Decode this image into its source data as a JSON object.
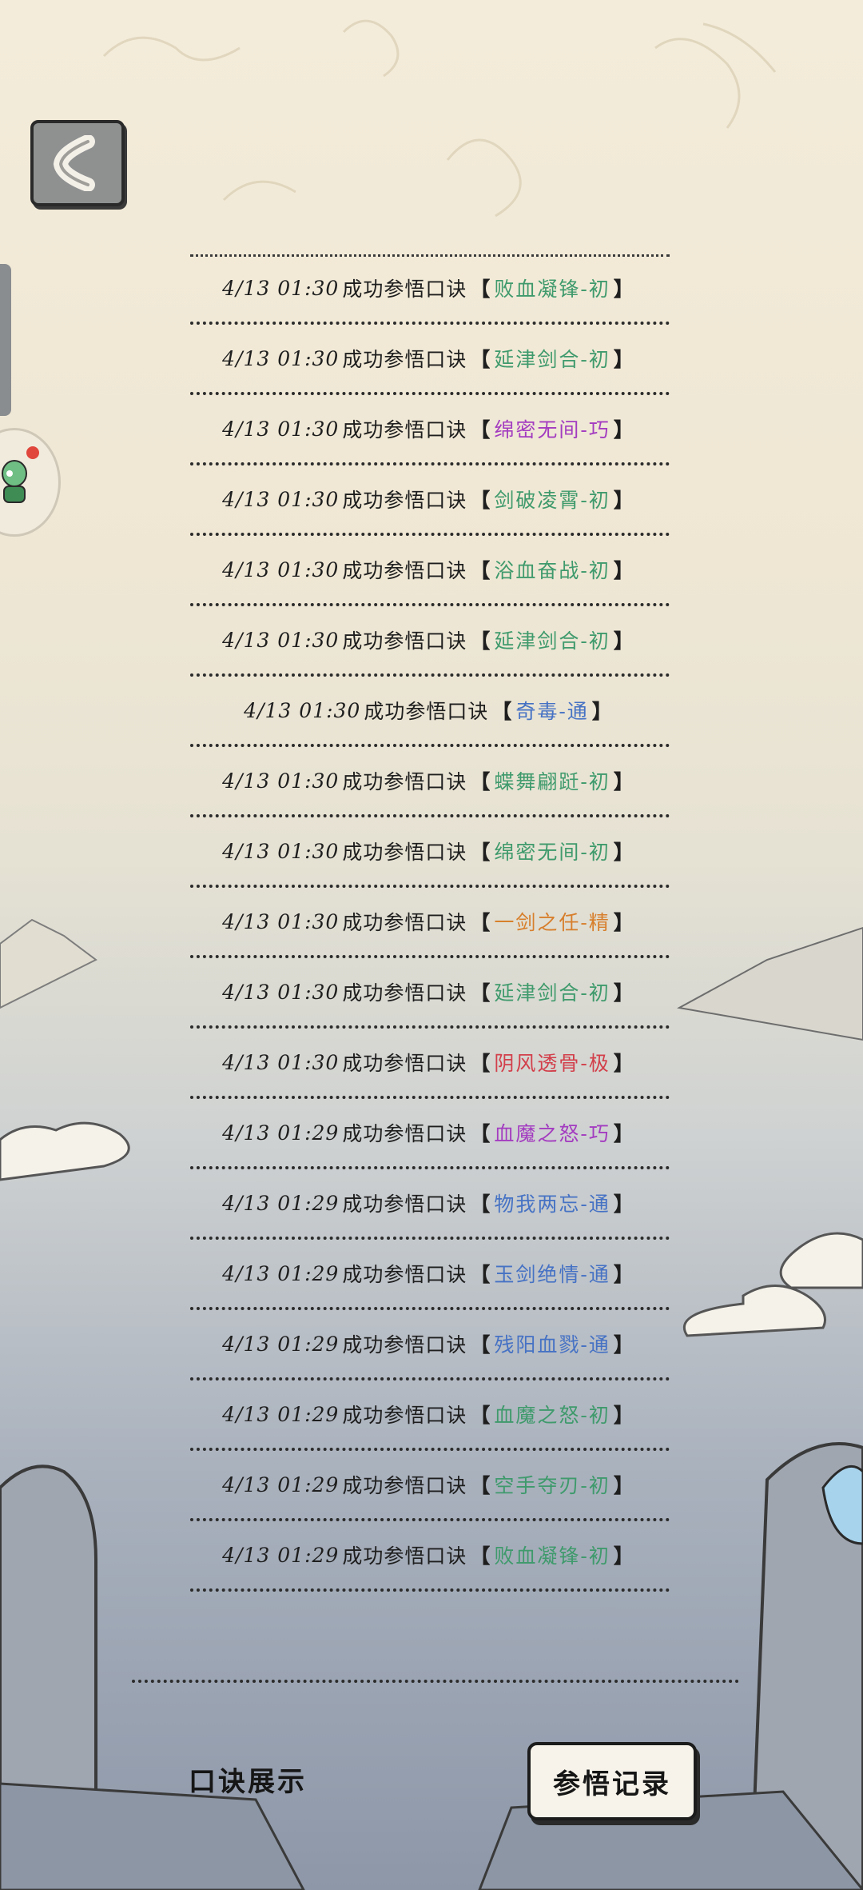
{
  "colors": {
    "green": "#3f9a6c",
    "purple": "#a33cc0",
    "blue": "#4672c4",
    "orange": "#d77f2c",
    "red": "#d23f4a"
  },
  "nav": {
    "back_icon": "chevron-left-icon",
    "side_icon": "ghost-character-icon"
  },
  "log": [
    {
      "time": "4/13 01:30",
      "text": "成功参悟口诀",
      "skill": "败血凝锋-初",
      "color": "green"
    },
    {
      "time": "4/13 01:30",
      "text": "成功参悟口诀",
      "skill": "延津剑合-初",
      "color": "green"
    },
    {
      "time": "4/13 01:30",
      "text": "成功参悟口诀",
      "skill": "绵密无间-巧",
      "color": "purple"
    },
    {
      "time": "4/13 01:30",
      "text": "成功参悟口诀",
      "skill": "剑破凌霄-初",
      "color": "green"
    },
    {
      "time": "4/13 01:30",
      "text": "成功参悟口诀",
      "skill": "浴血奋战-初",
      "color": "green"
    },
    {
      "time": "4/13 01:30",
      "text": "成功参悟口诀",
      "skill": "延津剑合-初",
      "color": "green"
    },
    {
      "time": "4/13 01:30",
      "text": "成功参悟口诀",
      "skill": "奇毒-通",
      "color": "blue"
    },
    {
      "time": "4/13 01:30",
      "text": "成功参悟口诀",
      "skill": "蝶舞翩跹-初",
      "color": "green"
    },
    {
      "time": "4/13 01:30",
      "text": "成功参悟口诀",
      "skill": "绵密无间-初",
      "color": "green"
    },
    {
      "time": "4/13 01:30",
      "text": "成功参悟口诀",
      "skill": "一剑之任-精",
      "color": "orange"
    },
    {
      "time": "4/13 01:30",
      "text": "成功参悟口诀",
      "skill": "延津剑合-初",
      "color": "green"
    },
    {
      "time": "4/13 01:30",
      "text": "成功参悟口诀",
      "skill": "阴风透骨-极",
      "color": "red"
    },
    {
      "time": "4/13 01:29",
      "text": "成功参悟口诀",
      "skill": "血魔之怒-巧",
      "color": "purple"
    },
    {
      "time": "4/13 01:29",
      "text": "成功参悟口诀",
      "skill": "物我两忘-通",
      "color": "blue"
    },
    {
      "time": "4/13 01:29",
      "text": "成功参悟口诀",
      "skill": "玉剑绝情-通",
      "color": "blue"
    },
    {
      "time": "4/13 01:29",
      "text": "成功参悟口诀",
      "skill": "残阳血戮-通",
      "color": "blue"
    },
    {
      "time": "4/13 01:29",
      "text": "成功参悟口诀",
      "skill": "血魔之怒-初",
      "color": "green"
    },
    {
      "time": "4/13 01:29",
      "text": "成功参悟口诀",
      "skill": "空手夺刃-初",
      "color": "green"
    },
    {
      "time": "4/13 01:29",
      "text": "成功参悟口诀",
      "skill": "败血凝锋-初",
      "color": "green"
    }
  ],
  "brackets": {
    "open": "【",
    "close": "】"
  },
  "tabs": {
    "display_label": "口诀展示",
    "record_label": "参悟记录"
  }
}
